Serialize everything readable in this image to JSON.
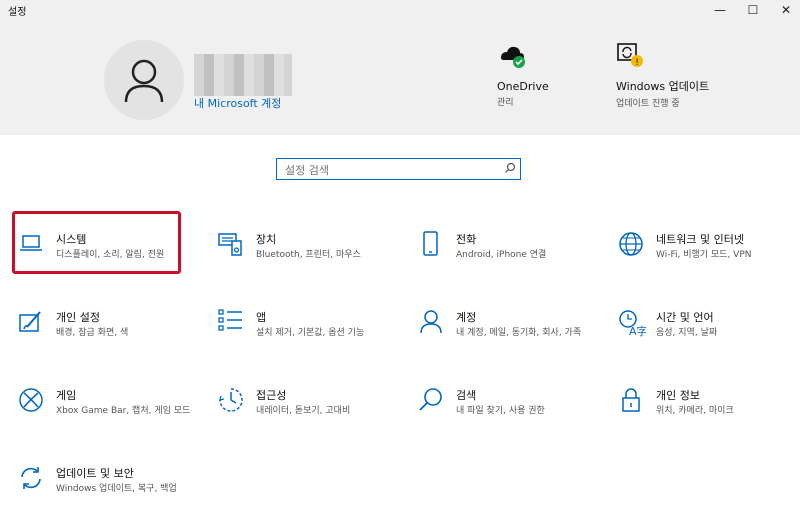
{
  "window": {
    "title": "설정",
    "minimize": "—",
    "maximize": "☐",
    "close": "✕"
  },
  "account": {
    "link": "내 Microsoft 계정"
  },
  "quick": [
    {
      "label": "OneDrive",
      "sub": "관리"
    },
    {
      "label": "Windows 업데이트",
      "sub": "업데이트 진행 중"
    }
  ],
  "search": {
    "placeholder": "설정 검색"
  },
  "tiles": [
    {
      "label": "시스템",
      "sub": "디스플레이, 소리, 알림, 전원",
      "icon": "laptop-icon"
    },
    {
      "label": "장치",
      "sub": "Bluetooth, 프린터, 마우스",
      "icon": "devices-icon"
    },
    {
      "label": "전화",
      "sub": "Android, iPhone 연결",
      "icon": "phone-icon"
    },
    {
      "label": "네트워크 및 인터넷",
      "sub": "Wi-Fi, 비행기 모드, VPN",
      "icon": "globe-icon"
    },
    {
      "label": "개인 설정",
      "sub": "배경, 잠금 화면, 색",
      "icon": "personalization-icon"
    },
    {
      "label": "앱",
      "sub": "설치 제거, 기본값, 옵션 기능",
      "icon": "apps-icon"
    },
    {
      "label": "계정",
      "sub": "내 계정, 메일, 동기화, 회사, 가족",
      "icon": "account-icon"
    },
    {
      "label": "시간 및 언어",
      "sub": "음성, 지역, 날짜",
      "icon": "time-language-icon"
    },
    {
      "label": "게임",
      "sub": "Xbox Game Bar, 캡처, 게임 모드",
      "icon": "xbox-icon"
    },
    {
      "label": "접근성",
      "sub": "내레이터, 돋보기, 고대비",
      "icon": "accessibility-icon"
    },
    {
      "label": "검색",
      "sub": "내 파일 찾기, 사용 권한",
      "icon": "search-icon"
    },
    {
      "label": "개인 정보",
      "sub": "위치, 카메라, 마이크",
      "icon": "lock-icon"
    },
    {
      "label": "업데이트 및 보안",
      "sub": "Windows 업데이트, 복구, 백업",
      "icon": "sync-icon"
    }
  ],
  "colors": {
    "accent": "#0067c0",
    "selection": "#c8102e",
    "header_bg": "#f0f0f0"
  }
}
